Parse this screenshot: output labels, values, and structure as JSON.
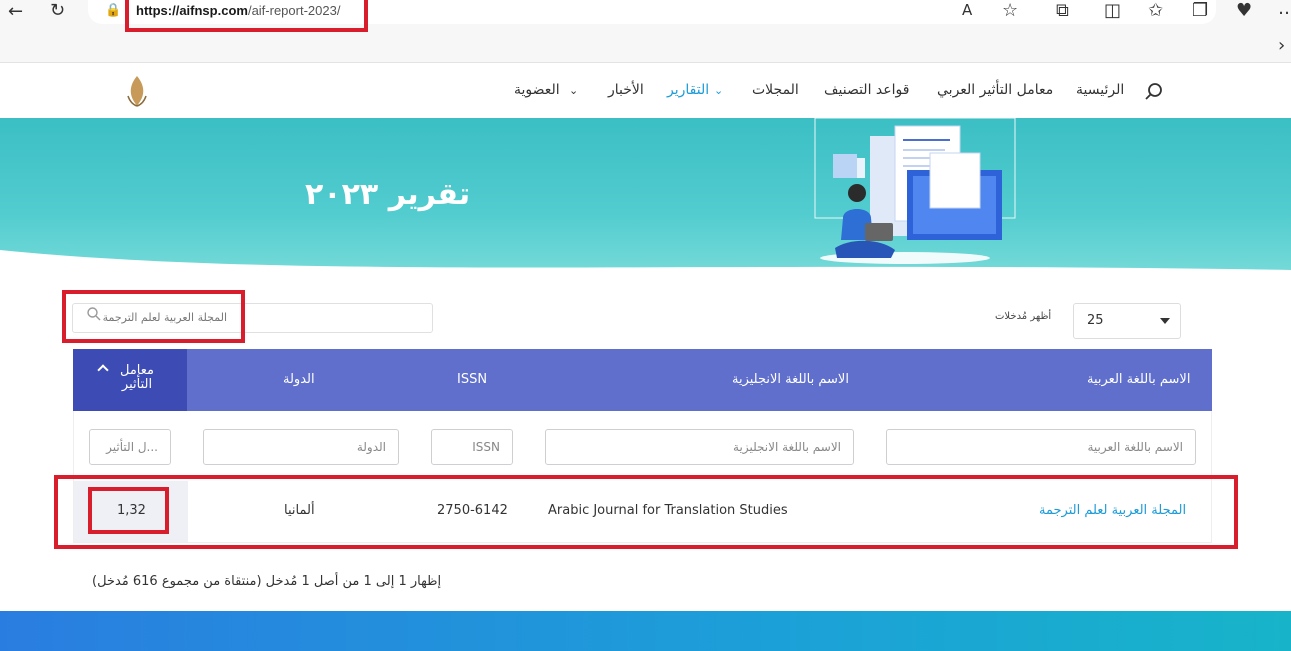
{
  "browser": {
    "url_domain": "https://aifnsp.com",
    "url_path": "/aif-report-2023/"
  },
  "nav": {
    "items": [
      {
        "label": "الرئيسية"
      },
      {
        "label": "معامل التأثير العربي"
      },
      {
        "label": "قواعد التصنيف"
      },
      {
        "label": "المجلات"
      },
      {
        "label": "التقارير"
      },
      {
        "label": "الأخبار"
      },
      {
        "label": "العضوية"
      }
    ]
  },
  "hero": {
    "title": "تقرير ٢٠٢٣"
  },
  "controls": {
    "search_value": "المجلة العربية لعلم الترجمة",
    "length_label": "أظهر مُدخلات",
    "length_value": "25"
  },
  "table": {
    "headers": {
      "name_ar": "الاسم باللغة العربية",
      "name_en": "الاسم باللغة الانجليزية",
      "issn": "ISSN",
      "country": "الدولة",
      "impact": "معامل التأثير"
    },
    "filters": {
      "name_ar": "الاسم باللغة العربية",
      "name_en": "الاسم باللغة الانجليزية",
      "issn": "ISSN",
      "country": "الدولة",
      "impact": "...ل التأثير"
    },
    "rows": [
      {
        "name_ar": "المجلة العربية لعلم الترجمة",
        "name_en": "Arabic Journal for Translation Studies",
        "issn": "2750-6142",
        "country": "ألمانيا",
        "impact": "1,32"
      }
    ]
  },
  "info": "إظهار 1 إلى 1 من أصل 1 مُدخل (منتقاة من مجموع 616 مُدخل)",
  "colors": {
    "header": "#5f6fcb",
    "header_sorted": "#3d4bb5",
    "accent_link": "#1c9bd8",
    "highlight_box": "#d81e2c",
    "hero": "#52cccf"
  }
}
